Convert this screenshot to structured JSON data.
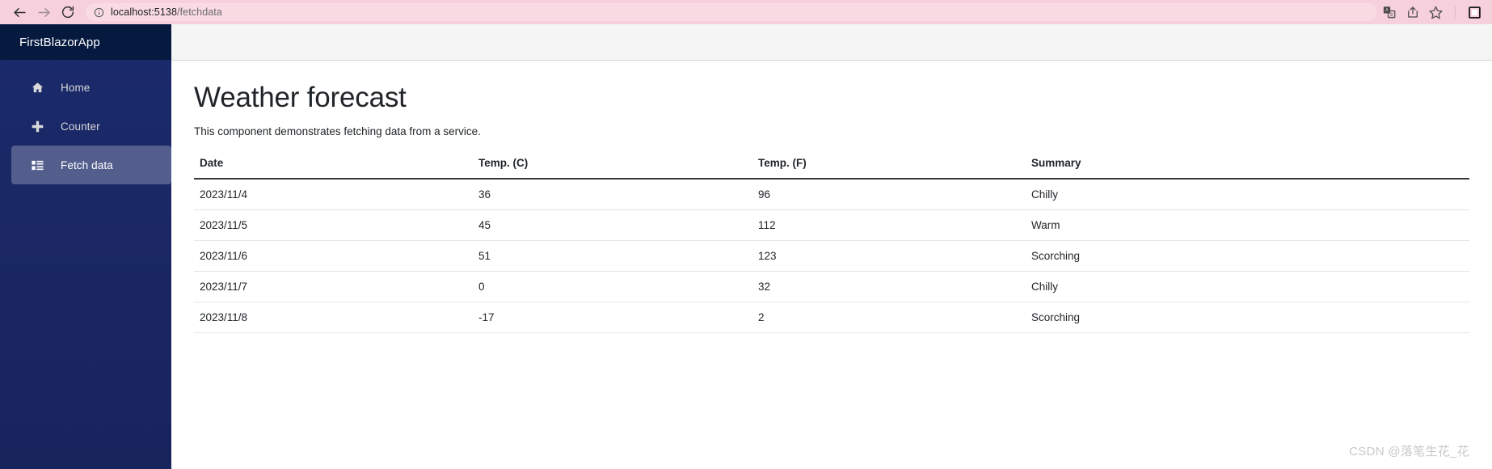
{
  "browser": {
    "back_label": "Back",
    "forward_label": "Forward",
    "reload_label": "Reload",
    "site_info_label": "View site information",
    "url_host": "localhost:5138",
    "url_path": "/fetchdata",
    "url_full": "localhost:5138/fetchdata",
    "actions": [
      {
        "name": "translate-icon",
        "label": "Translate this page"
      },
      {
        "name": "share-icon",
        "label": "Share this page"
      },
      {
        "name": "favorite-star-icon",
        "label": "Add this page to favorites"
      },
      {
        "name": "sidebar-panel-icon",
        "label": "Browser essentials"
      }
    ]
  },
  "sidebar": {
    "brand": "FirstBlazorApp",
    "items": [
      {
        "label": "Home",
        "icon": "home-icon",
        "active": false
      },
      {
        "label": "Counter",
        "icon": "plus-icon",
        "active": false
      },
      {
        "label": "Fetch data",
        "icon": "list-grid-icon",
        "active": true
      }
    ]
  },
  "main": {
    "title": "Weather forecast",
    "description": "This component demonstrates fetching data from a service.",
    "table": {
      "columns": [
        "Date",
        "Temp. (C)",
        "Temp. (F)",
        "Summary"
      ],
      "rows": [
        [
          "2023/11/4",
          "36",
          "96",
          "Chilly"
        ],
        [
          "2023/11/5",
          "45",
          "112",
          "Warm"
        ],
        [
          "2023/11/6",
          "51",
          "123",
          "Scorching"
        ],
        [
          "2023/11/7",
          "0",
          "32",
          "Chilly"
        ],
        [
          "2023/11/8",
          "-17",
          "2",
          "Scorching"
        ]
      ]
    }
  },
  "watermark": "CSDN @落笔生花_花",
  "colors": {
    "browser_bar": "#f6d0dc",
    "omnibox": "#fadbe4",
    "sidebar_top": "#1b2a6b",
    "sidebar_bottom": "#18245c",
    "brand_bg": "#061a40",
    "topbar_bg": "#f5f5f5",
    "text": "#212529"
  }
}
